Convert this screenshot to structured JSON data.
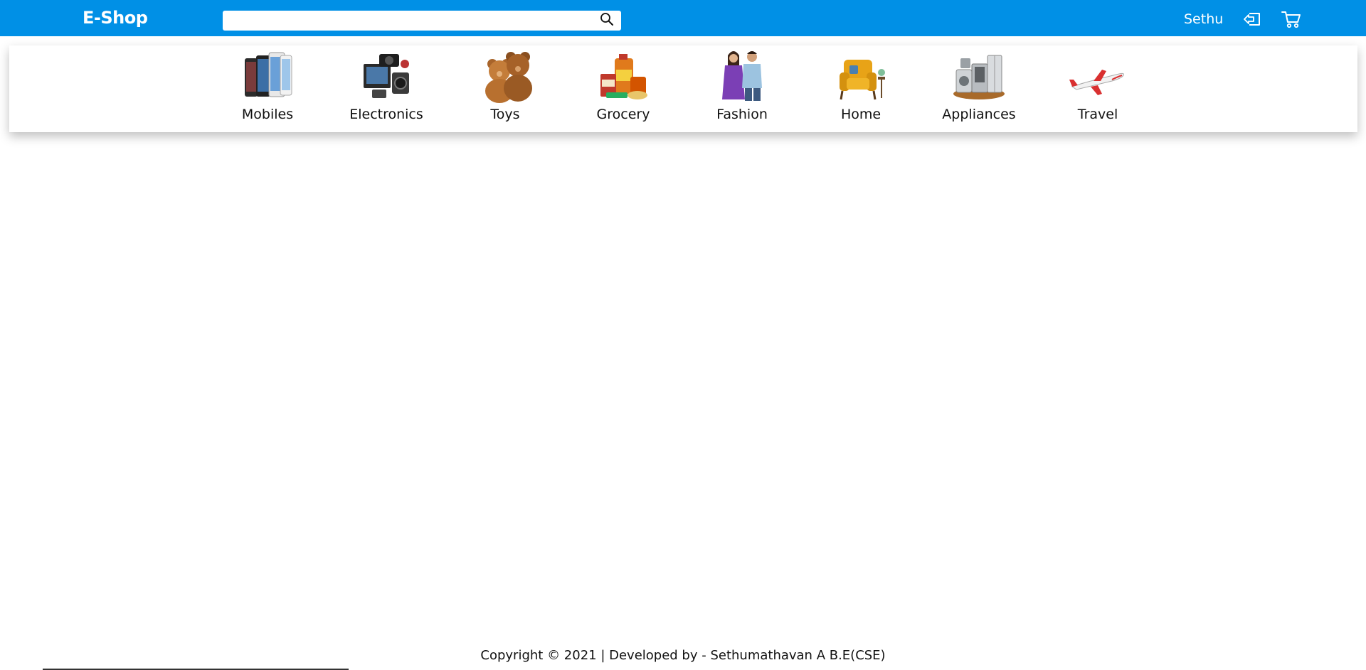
{
  "header": {
    "brand": "E-Shop",
    "search": {
      "value": "",
      "placeholder": "",
      "icon": "search-icon"
    },
    "user_name": "Sethu",
    "logout_icon": "logout-icon",
    "cart_icon": "cart-icon",
    "bg_color": "#0090e6"
  },
  "categories": [
    {
      "label": "Mobiles",
      "icon": "mobiles-image"
    },
    {
      "label": "Electronics",
      "icon": "electronics-image"
    },
    {
      "label": "Toys",
      "icon": "teddy-bears-image"
    },
    {
      "label": "Grocery",
      "icon": "grocery-image"
    },
    {
      "label": "Fashion",
      "icon": "fashion-models-image"
    },
    {
      "label": "Home",
      "icon": "armchair-image"
    },
    {
      "label": "Appliances",
      "icon": "appliances-image"
    },
    {
      "label": "Travel",
      "icon": "airplane-image"
    }
  ],
  "footer": {
    "text": "Copyright © 2021 | Developed by - Sethumathavan A B.E(CSE)"
  }
}
